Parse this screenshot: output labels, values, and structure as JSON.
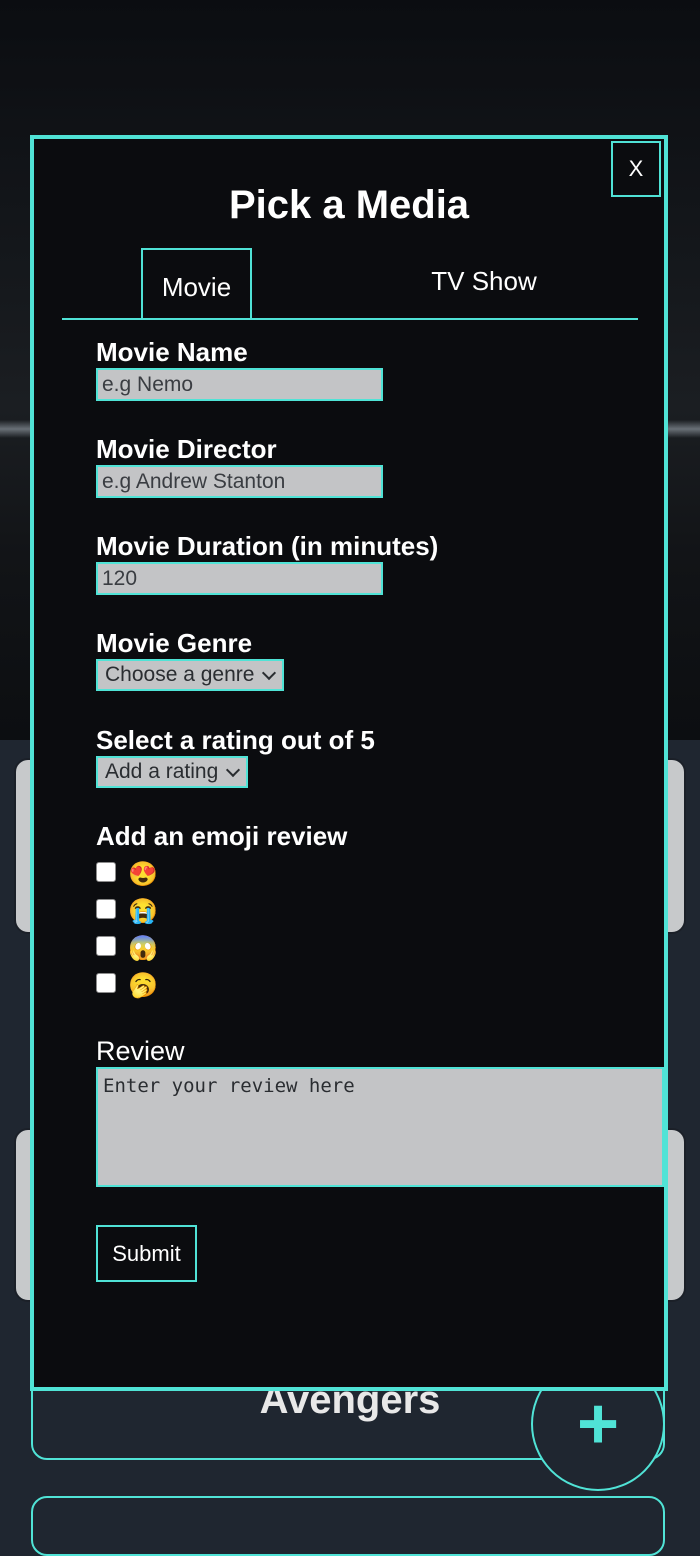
{
  "background": {
    "card_title": "Avengers",
    "fab_label": "+"
  },
  "modal": {
    "close_label": "X",
    "title": "Pick a Media",
    "tabs": [
      {
        "label": "Movie",
        "active": true
      },
      {
        "label": "TV Show",
        "active": false
      }
    ],
    "fields": {
      "name": {
        "label": "Movie Name",
        "placeholder": "e.g Nemo"
      },
      "director": {
        "label": "Movie Director",
        "placeholder": "e.g Andrew Stanton"
      },
      "duration": {
        "label": "Movie Duration (in minutes)",
        "placeholder": "120"
      },
      "genre": {
        "label": "Movie Genre",
        "selected": "Choose a genre"
      },
      "rating": {
        "label": "Select a rating out of 5",
        "selected": "Add a rating"
      },
      "emoji": {
        "label": "Add an emoji review",
        "options": [
          {
            "emoji": "😍",
            "checked": false
          },
          {
            "emoji": "😭",
            "checked": false
          },
          {
            "emoji": "😱",
            "checked": false
          },
          {
            "emoji": "🥱",
            "checked": false
          }
        ]
      },
      "review": {
        "label": "Review",
        "placeholder": "Enter your review here"
      }
    },
    "submit_label": "Submit"
  },
  "colors": {
    "accent": "#50e3d6",
    "modal_bg": "#0b0c0f",
    "input_bg": "#c3c4c6",
    "page_bg": "#1f2630"
  }
}
